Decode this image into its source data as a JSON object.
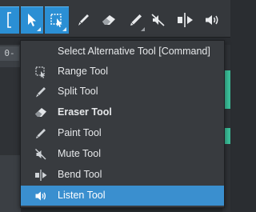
{
  "toolbar": {
    "tools": [
      {
        "name": "bracket-tool",
        "selected": true
      },
      {
        "name": "arrow-tool",
        "selected": true
      },
      {
        "name": "range-tool",
        "selected": true
      },
      {
        "name": "paint-tool",
        "selected": false
      },
      {
        "name": "eraser-tool",
        "selected": false
      },
      {
        "name": "pencil-tool",
        "selected": false
      },
      {
        "name": "mute-tool",
        "selected": false
      },
      {
        "name": "bend-tool",
        "selected": false
      },
      {
        "name": "listen-tool",
        "selected": false
      }
    ]
  },
  "background": {
    "left_tab_text": "0-"
  },
  "menu": {
    "items": [
      {
        "label": "Select Alternative Tool [Command]",
        "icon": "none",
        "bold": false,
        "highlighted": false
      },
      {
        "label": "Range Tool",
        "icon": "range-icon",
        "bold": false,
        "highlighted": false
      },
      {
        "label": "Split Tool",
        "icon": "split-icon",
        "bold": false,
        "highlighted": false
      },
      {
        "label": "Eraser Tool",
        "icon": "eraser-icon",
        "bold": true,
        "highlighted": false
      },
      {
        "label": "Paint Tool",
        "icon": "paint-icon",
        "bold": false,
        "highlighted": false
      },
      {
        "label": "Mute Tool",
        "icon": "mute-icon",
        "bold": false,
        "highlighted": false
      },
      {
        "label": "Bend Tool",
        "icon": "bend-icon",
        "bold": false,
        "highlighted": false
      },
      {
        "label": "Listen Tool",
        "icon": "listen-icon",
        "bold": false,
        "highlighted": true
      }
    ]
  },
  "colors": {
    "accent": "#2b8fd4",
    "highlight": "#3a8fcf",
    "wave": "#3bbf9a"
  }
}
